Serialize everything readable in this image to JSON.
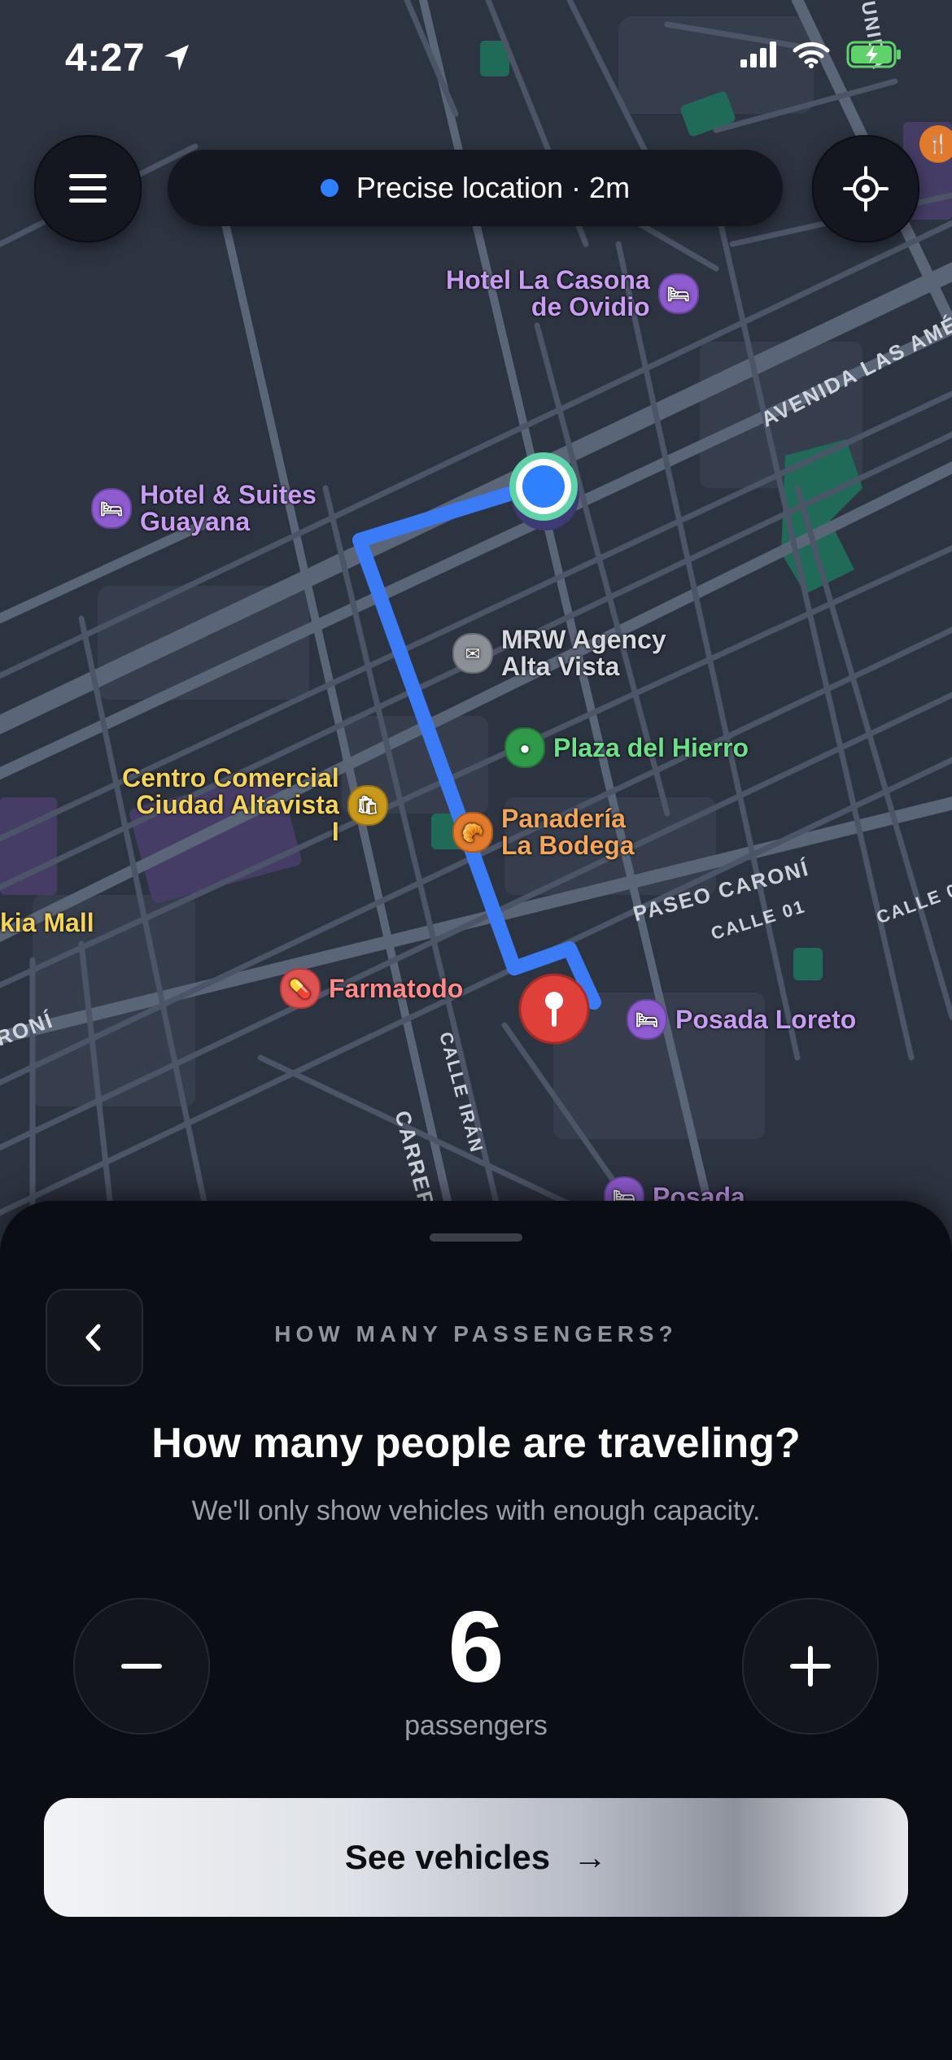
{
  "status_bar": {
    "time": "4:27"
  },
  "location_pill": {
    "text": "Precise location · 2m"
  },
  "map": {
    "pois": [
      {
        "id": "hotel-la-casona",
        "name_line1": "Hotel La Casona",
        "name_line2": "de Ovidio",
        "icon": "bed-icon"
      },
      {
        "id": "hotel-suites-guayana",
        "name_line1": "Hotel & Suites",
        "name_line2": "Guayana",
        "icon": "bed-icon"
      },
      {
        "id": "mrw-agency",
        "name_line1": "MRW Agency",
        "name_line2": "Alta Vista",
        "icon": "mail-icon"
      },
      {
        "id": "plaza-del-hierro",
        "name_line1": "Plaza del Hierro",
        "name_line2": "",
        "icon": "park-icon"
      },
      {
        "id": "centro-comercial",
        "name_line1": "Centro Comercial",
        "name_line2": "Ciudad Altavista",
        "name_line3": "I",
        "icon": "shopping-icon"
      },
      {
        "id": "panaderia",
        "name_line1": "Panadería",
        "name_line2": "La Bodega",
        "icon": "bakery-icon"
      },
      {
        "id": "kia-mall",
        "name_line1": "kia Mall",
        "name_line2": "",
        "icon": ""
      },
      {
        "id": "farmatodo",
        "name_line1": "Farmatodo",
        "name_line2": "",
        "icon": "pharmacy-icon"
      },
      {
        "id": "posada-loreto",
        "name_line1": "Posada Loreto",
        "name_line2": "",
        "icon": "bed-icon"
      },
      {
        "id": "posada",
        "name_line1": "Posada",
        "name_line2": "",
        "icon": "bed-icon"
      }
    ],
    "roads": {
      "avenida": "AVENIDA LAS AMÉRIC",
      "paseo": "PASEO CARONÍ",
      "calle01a": "CALLE 01",
      "calle01b": "CALLE 0",
      "calle_iran": "CALLE IRÁN",
      "carrera": "CARRERA",
      "unidad": "UNIDA",
      "caroni_left": "RONÍ"
    }
  },
  "sheet": {
    "step_title": "HOW MANY PASSENGERS?",
    "question": "How many people are traveling?",
    "subtitle": "We'll only show vehicles with enough capacity.",
    "passenger_count": "6",
    "count_label": "passengers",
    "cta_label": "See vehicles",
    "cta_arrow": "→"
  },
  "colors": {
    "route": "#3b7bf6",
    "sheet_bg": "#0b0d14",
    "accent_dot": "#2f80ff",
    "destination_pin": "#e0403a"
  }
}
